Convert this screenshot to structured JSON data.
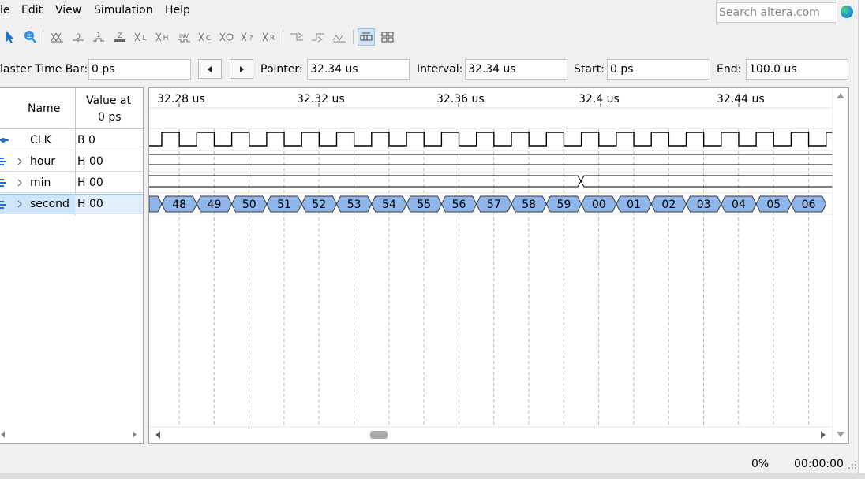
{
  "menu": [
    "le",
    "Edit",
    "View",
    "Simulation",
    "Help"
  ],
  "search": {
    "placeholder": "Search altera.com"
  },
  "toolbar": {
    "icons": [
      "pointer-tool-icon",
      "zoom-tool-icon",
      "forcing-unknown-icon",
      "forcing-low-icon",
      "forcing-high-icon",
      "high-impedance-icon",
      "weak-low-icon",
      "weak-high-icon",
      "invert-icon",
      "count-value-icon",
      "overwrite-clock-icon",
      "random-values-icon",
      "value-icon",
      "snap-to-grid-icon",
      "shift-left-icon",
      "shift-right-icon",
      "grid-icon",
      "grouping-icon"
    ]
  },
  "timebar": {
    "master_label": "laster Time Bar:",
    "master_value": "0 ps",
    "pointer_label": "Pointer:",
    "pointer_value": "32.34 us",
    "interval_label": "Interval:",
    "interval_value": "32.34 us",
    "start_label": "Start:",
    "start_value": "0 ps",
    "end_label": "End:",
    "end_value": "100.0 us"
  },
  "nodes": {
    "header_name": "Name",
    "header_value_1": "Value at",
    "header_value_2": "0 ps",
    "rows": [
      {
        "name": "CLK",
        "value": "B 0",
        "expandable": false
      },
      {
        "name": "hour",
        "value": "H 00",
        "expandable": true
      },
      {
        "name": "min",
        "value": "H 00",
        "expandable": true
      },
      {
        "name": "second",
        "value": "H 00",
        "expandable": true,
        "selected": true
      }
    ]
  },
  "time_axis": {
    "labels": [
      "32.28 us",
      "32.32 us",
      "32.36 us",
      "32.4 us",
      "32.44 us"
    ]
  },
  "second_values": [
    "48",
    "49",
    "50",
    "51",
    "52",
    "53",
    "54",
    "55",
    "56",
    "57",
    "58",
    "59",
    "00",
    "01",
    "02",
    "03",
    "04",
    "05",
    "06"
  ],
  "status": {
    "progress": "0%",
    "elapsed": "00:00:00"
  },
  "colors": {
    "bus_fill": "#8fb6ea",
    "bus_stroke": "#3a3a3a",
    "selected_row": "#cde4fa",
    "accent": "#1e6fd9"
  }
}
